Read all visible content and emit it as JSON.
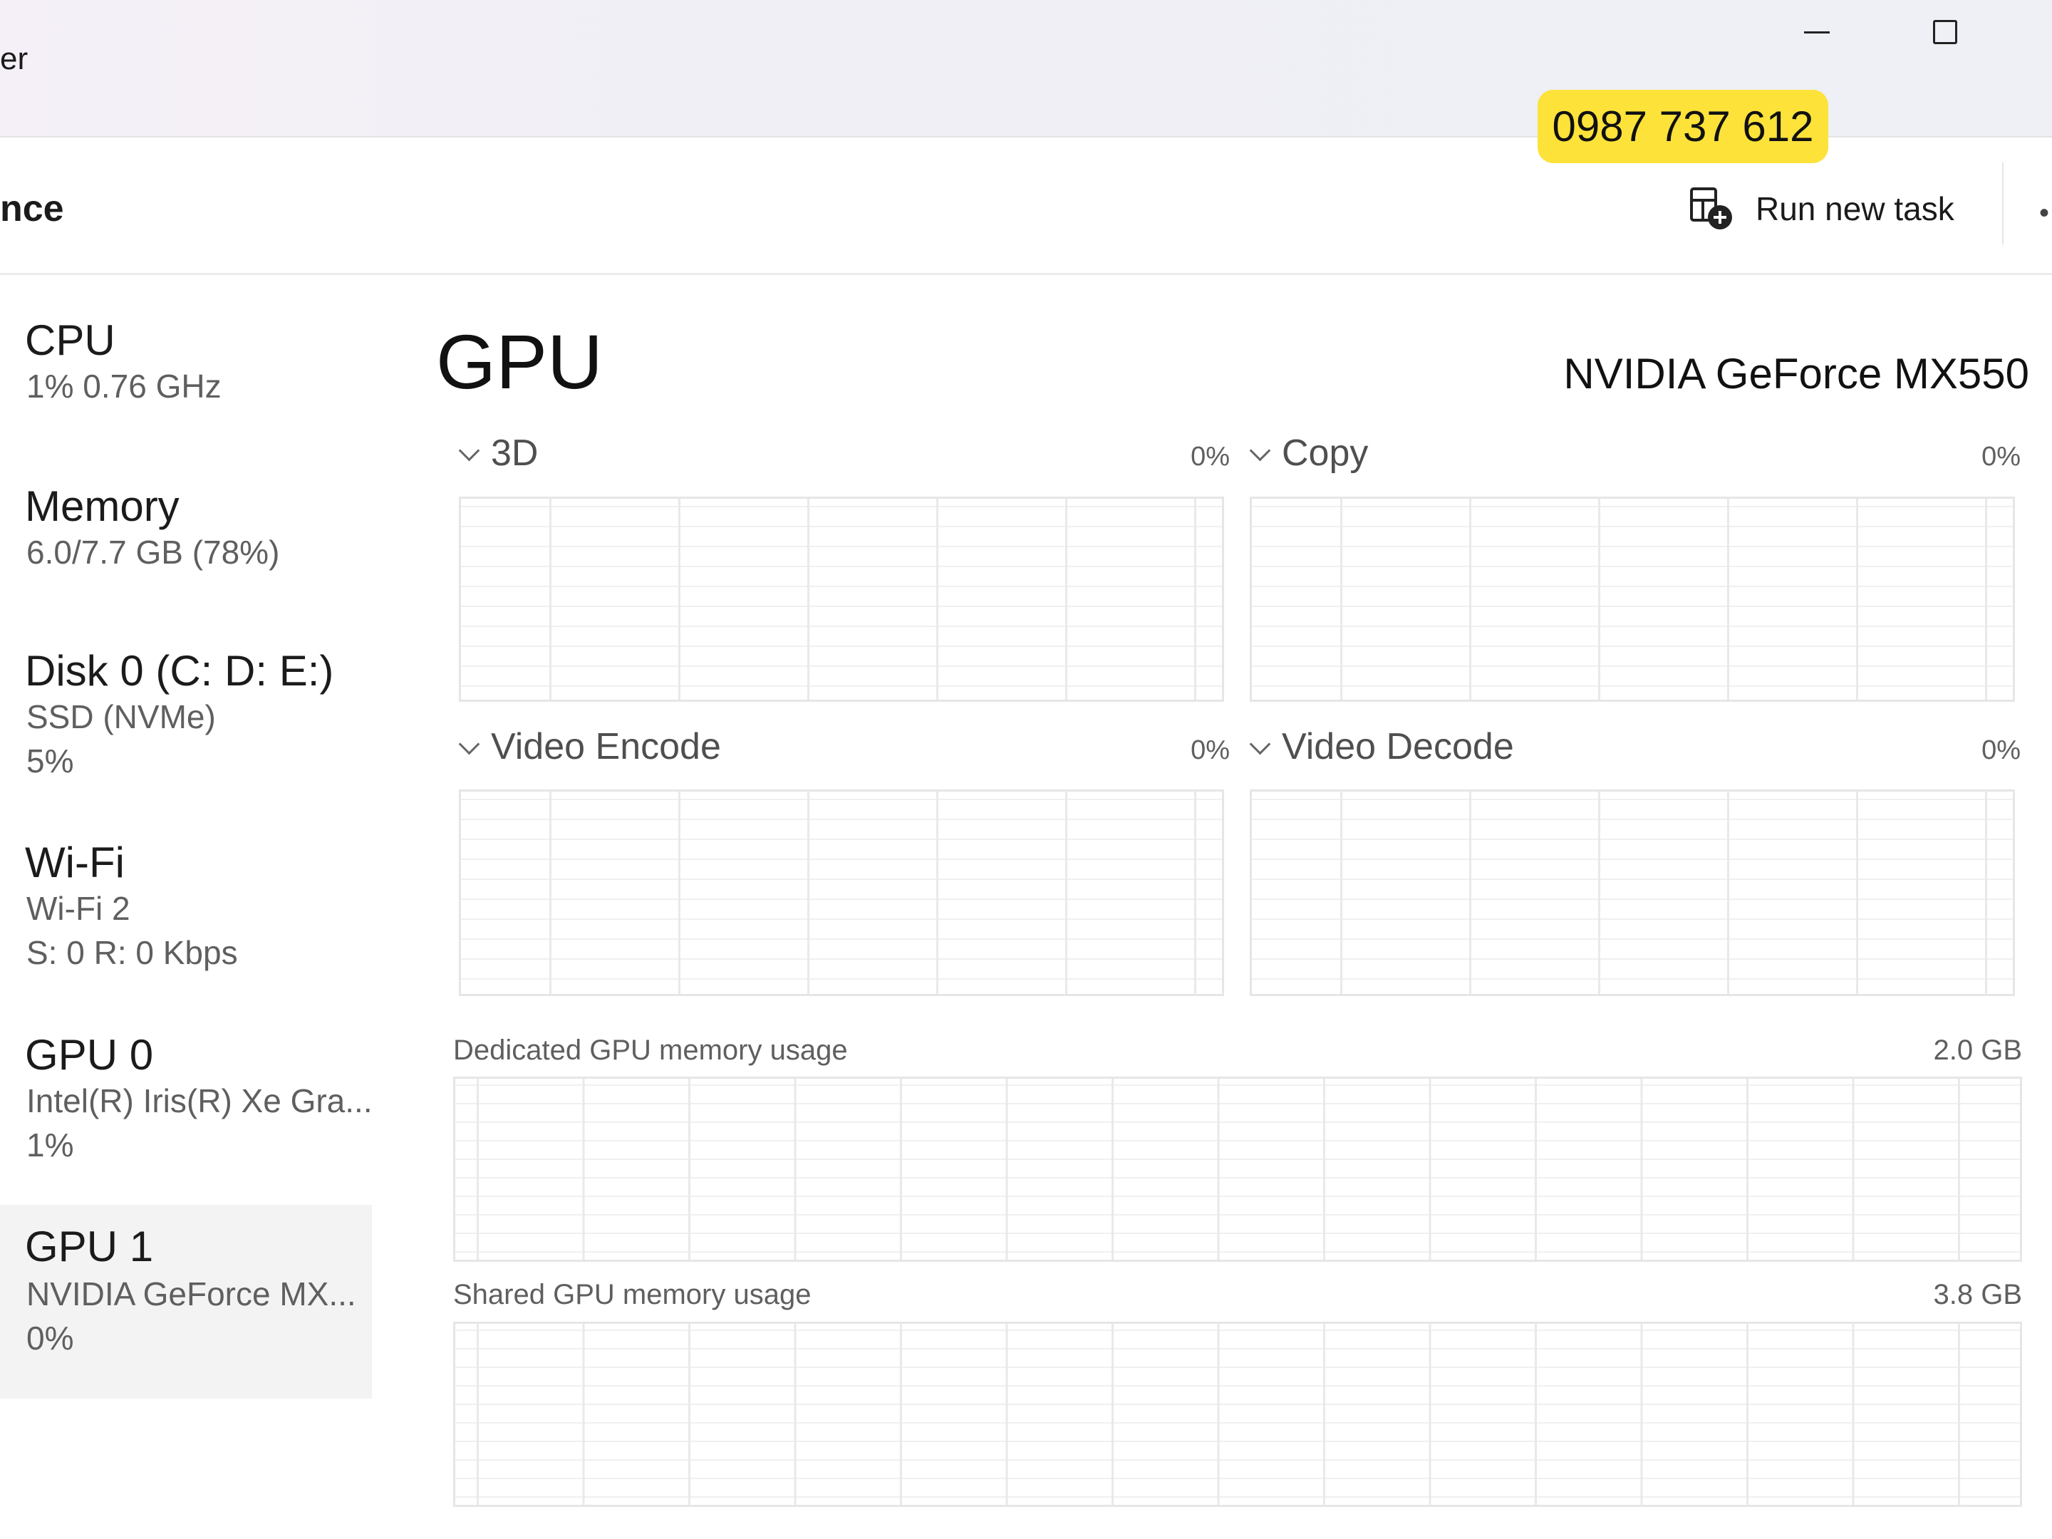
{
  "titlebar": {
    "app_title": "er"
  },
  "commandbar": {
    "page_heading": "nce",
    "run_new_task": "Run new task"
  },
  "overlay_badge": {
    "text": "0987 737 612",
    "color": "#fde23a"
  },
  "sidebar": {
    "items": [
      {
        "title": "CPU",
        "line1": "1% 0.76 GHz",
        "line2": ""
      },
      {
        "title": "Memory",
        "line1": "6.0/7.7 GB (78%)",
        "line2": ""
      },
      {
        "title": "Disk 0 (C: D: E:)",
        "line1": "SSD (NVMe)",
        "line2": "5%"
      },
      {
        "title": "Wi-Fi",
        "line1": "Wi-Fi 2",
        "line2": "S: 0 R: 0 Kbps"
      },
      {
        "title": "GPU 0",
        "line1": "Intel(R) Iris(R) Xe Gra...",
        "line2": "1%"
      },
      {
        "title": "GPU 1",
        "line1": "NVIDIA GeForce MX...",
        "line2": "0%",
        "selected": true
      }
    ]
  },
  "main": {
    "title": "GPU",
    "device_name": "NVIDIA GeForce MX550",
    "engines": [
      {
        "label": "3D",
        "percent": "0%"
      },
      {
        "label": "Copy",
        "percent": "0%"
      },
      {
        "label": "Video Encode",
        "percent": "0%"
      },
      {
        "label": "Video Decode",
        "percent": "0%"
      }
    ],
    "dedicated_memory": {
      "label": "Dedicated GPU memory usage",
      "value": "2.0 GB"
    },
    "shared_memory": {
      "label": "Shared GPU memory usage",
      "value": "3.8 GB"
    }
  }
}
